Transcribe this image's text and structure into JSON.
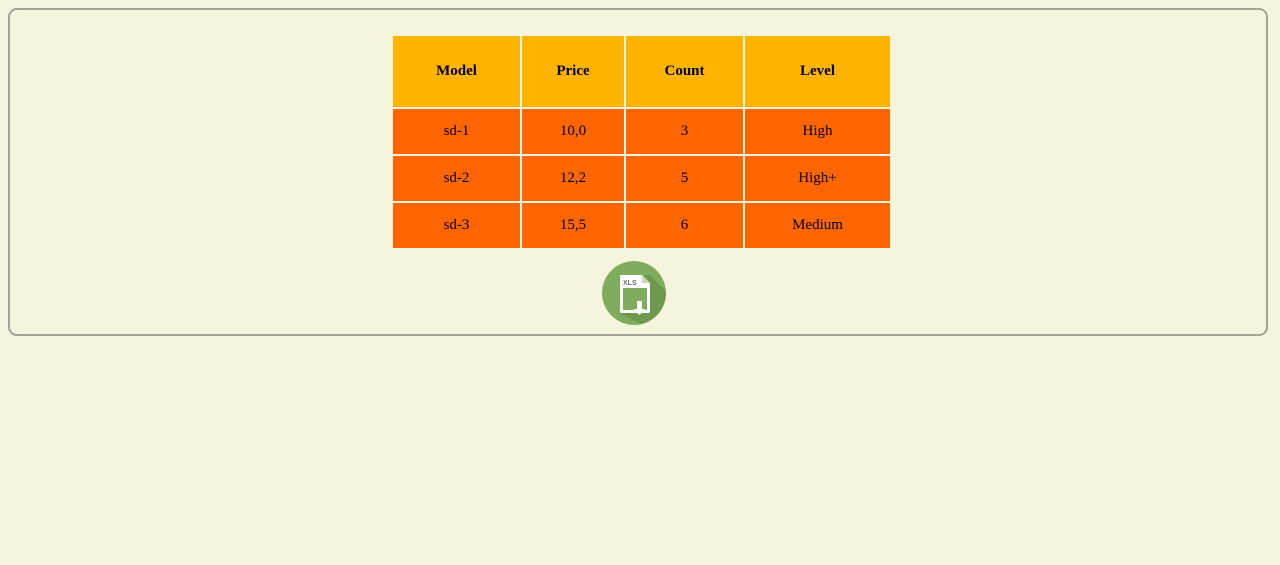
{
  "table": {
    "headers": [
      "Model",
      "Price",
      "Count",
      "Level"
    ],
    "rows": [
      [
        "sd-1",
        "10,0",
        "3",
        "High"
      ],
      [
        "sd-2",
        "12,2",
        "5",
        "High+"
      ],
      [
        "sd-3",
        "15,5",
        "6",
        "Medium"
      ]
    ]
  },
  "export": {
    "icon": "xls-download-icon",
    "icon_text": "XLS"
  },
  "colors": {
    "background": "#f5f4dc",
    "header": "#ffb400",
    "cell": "#ff6601",
    "icon_circle": "#80ac5d"
  }
}
